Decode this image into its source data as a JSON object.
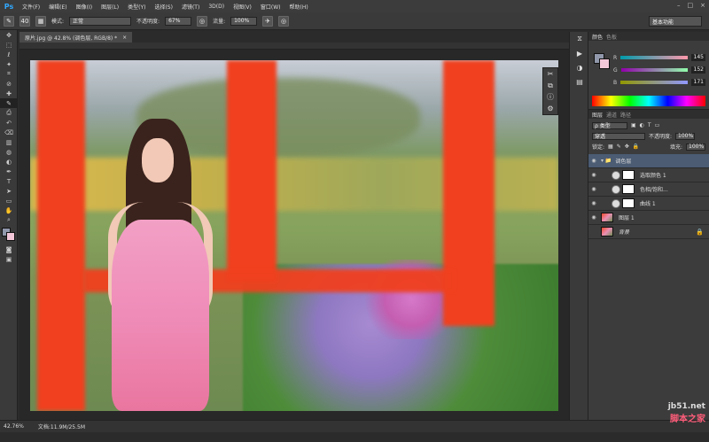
{
  "app": {
    "logo": "Ps"
  },
  "menu": [
    "文件(F)",
    "编辑(E)",
    "图像(I)",
    "图层(L)",
    "类型(Y)",
    "选择(S)",
    "滤镜(T)",
    "3D(D)",
    "视图(V)",
    "窗口(W)",
    "帮助(H)"
  ],
  "options": {
    "brush_size": "40",
    "mode_label": "模式:",
    "mode_value": "正常",
    "opacity_label": "不透明度:",
    "opacity_value": "67%",
    "flow_label": "流量:",
    "flow_value": "100%",
    "workspace": "基本功能"
  },
  "document": {
    "tab_title": "原片.jpg @ 42.8% (调色层, RGB/8) *",
    "close": "×"
  },
  "toolbar": {
    "icons": [
      "move-icon",
      "marquee-icon",
      "lasso-icon",
      "wand-icon",
      "crop-icon",
      "eyedropper-icon",
      "healing-icon",
      "brush-icon",
      "stamp-icon",
      "history-icon",
      "eraser-icon",
      "gradient-icon",
      "blur-icon",
      "dodge-icon",
      "pen-icon",
      "type-icon",
      "path-icon",
      "shape-icon",
      "hand-icon",
      "zoom-icon"
    ],
    "glyphs": [
      "✥",
      "⬚",
      "ℓ",
      "✦",
      "⌗",
      "⊘",
      "✚",
      "✎",
      "⎙",
      "↶",
      "⌫",
      "▥",
      "◍",
      "◐",
      "✒",
      "T",
      "➤",
      "▭",
      "✋",
      "⌕"
    ]
  },
  "color_panel": {
    "tab1": "颜色",
    "tab2": "色板",
    "r_label": "R",
    "r_value": "145",
    "g_label": "G",
    "g_value": "152",
    "b_label": "B",
    "b_value": "171",
    "fg_color": "#9198ab",
    "bg_color": "#f3c6d8"
  },
  "layers_panel": {
    "tab1": "图层",
    "tab2": "通道",
    "tab3": "路径",
    "filter": "ρ 类型",
    "blend": "穿透",
    "opacity_label": "不透明度:",
    "opacity_value": "100%",
    "lock_label": "锁定:",
    "fill_label": "填充:",
    "fill_value": "100%",
    "layers": [
      {
        "name": "调色层",
        "type": "group",
        "selected": true
      },
      {
        "name": "选取颜色 1",
        "type": "adjustment"
      },
      {
        "name": "色相/饱和...",
        "type": "adjustment"
      },
      {
        "name": "曲线 1",
        "type": "adjustment"
      },
      {
        "name": "图层 1",
        "type": "pixel"
      },
      {
        "name": "背景",
        "type": "background",
        "locked": true
      }
    ]
  },
  "status": {
    "zoom": "42.76%",
    "doc_info": "文档:11.9M/25.5M"
  },
  "watermark": {
    "line1": "jb51.net",
    "line2": "脚本之家"
  }
}
